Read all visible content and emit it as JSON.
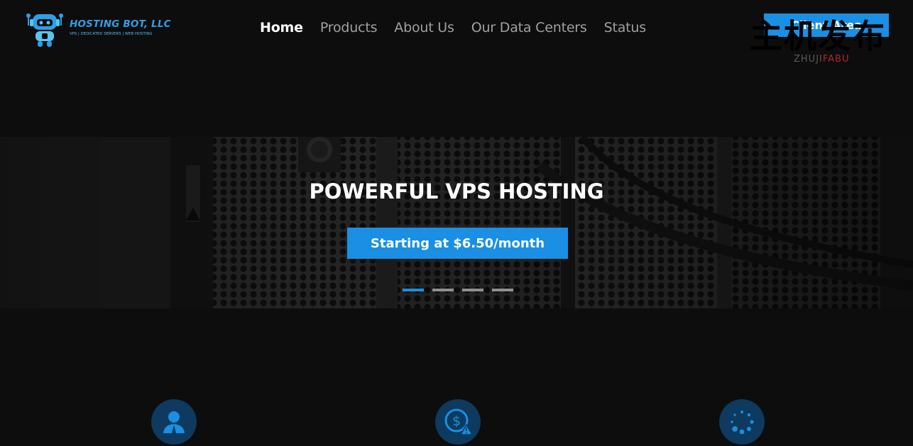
{
  "brand": {
    "name": "HOSTING BOT, LLC",
    "tagline": "VPS | DEDICATED SERVERS | WEB HOSTING"
  },
  "nav": {
    "items": [
      {
        "label": "Home",
        "active": true
      },
      {
        "label": "Products",
        "active": false
      },
      {
        "label": "About Us",
        "active": false
      },
      {
        "label": "Our Data Centers",
        "active": false
      },
      {
        "label": "Status",
        "active": false
      }
    ]
  },
  "header": {
    "client_button_label": "Client Area"
  },
  "watermark": {
    "chinese": "主机发布",
    "sub_a": "ZHUJI",
    "sub_b": "FABU"
  },
  "hero": {
    "title": "POWERFUL VPS HOSTING",
    "button_label": "Starting at $6.50/month",
    "slides_count": 4,
    "active_slide": 1
  },
  "features": {
    "icons": [
      "user-icon",
      "dollar-warning-icon",
      "loading-spinner-icon"
    ]
  },
  "colors": {
    "accent": "#1a8fe3",
    "background": "#0d0d0d",
    "icon_circle": "#0d3a5e"
  }
}
